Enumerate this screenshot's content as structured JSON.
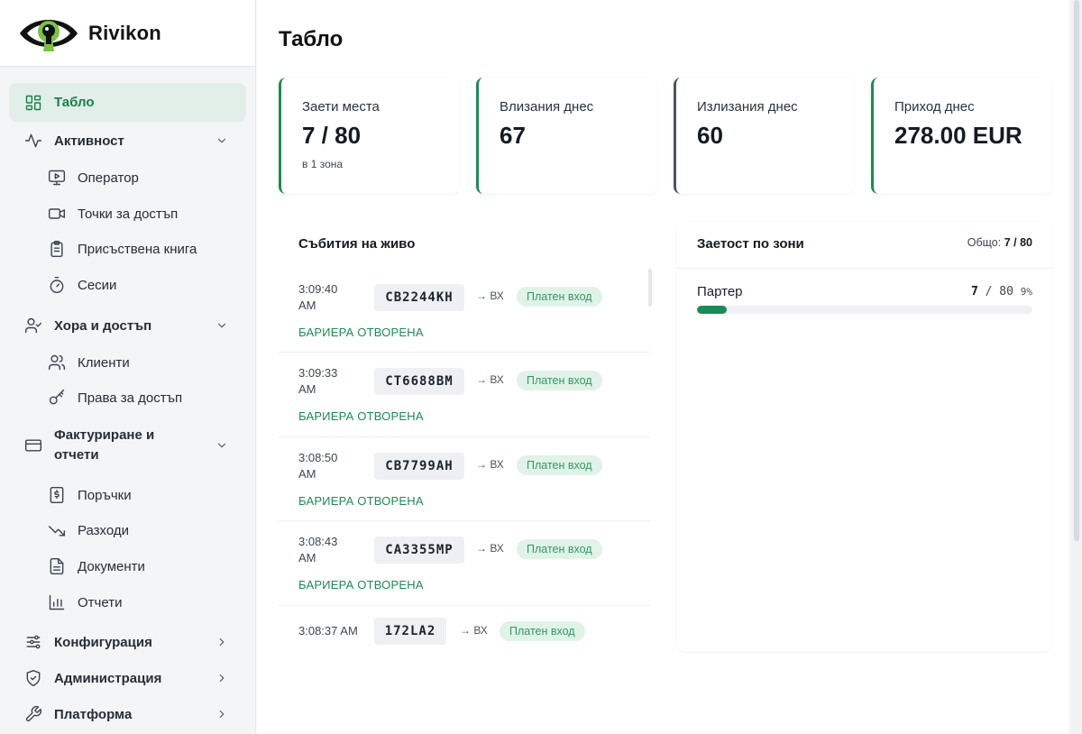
{
  "brand": {
    "name": "Rivikon"
  },
  "sidebar": {
    "items": [
      {
        "label": "Табло",
        "icon": "dashboard-icon",
        "active": true
      },
      {
        "label": "Активност",
        "icon": "activity-icon",
        "expandable": true
      },
      {
        "label": "Оператор",
        "icon": "monitor-play-icon"
      },
      {
        "label": "Точки за достъп",
        "icon": "camera-icon"
      },
      {
        "label": "Присъствена книга",
        "icon": "clipboard-icon"
      },
      {
        "label": "Сесии",
        "icon": "timer-icon"
      },
      {
        "label": "Хора и достъп",
        "icon": "user-check-icon",
        "expandable": true
      },
      {
        "label": "Клиенти",
        "icon": "users-icon"
      },
      {
        "label": "Права за достъп",
        "icon": "key-icon"
      },
      {
        "label": "Фактуриране и",
        "label2": "отчети",
        "icon": "credit-card-icon",
        "expandable": true
      },
      {
        "label": "Поръчки",
        "icon": "receipt-icon"
      },
      {
        "label": "Разходи",
        "icon": "trending-down-icon"
      },
      {
        "label": "Документи",
        "icon": "file-text-icon"
      },
      {
        "label": "Отчети",
        "icon": "bar-chart-icon"
      },
      {
        "label": "Конфигурация",
        "icon": "sliders-icon"
      },
      {
        "label": "Администрация",
        "icon": "shield-icon"
      },
      {
        "label": "Платформа",
        "icon": "wrench-icon"
      }
    ]
  },
  "page": {
    "title": "Табло"
  },
  "kpis": [
    {
      "label": "Заети места",
      "value": "7 / 80",
      "sub": "в 1 зона"
    },
    {
      "label": "Влизания днес",
      "value": "67"
    },
    {
      "label": "Излизания днес",
      "value": "60"
    },
    {
      "label": "Приход днес",
      "value": "278.00 EUR"
    }
  ],
  "events": {
    "title": "Събития на живо",
    "items": [
      {
        "time": "3:09:40 AM",
        "plate": "CB2244KH",
        "direction": "→ ВХ",
        "tag": "Платен вход",
        "result": "БАРИЕРА ОТВОРЕНА"
      },
      {
        "time": "3:09:33 AM",
        "plate": "CT6688BM",
        "direction": "→ ВХ",
        "tag": "Платен вход",
        "result": "БАРИЕРА ОТВОРЕНА"
      },
      {
        "time": "3:08:50 AM",
        "plate": "CB7799AH",
        "direction": "→ ВХ",
        "tag": "Платен вход",
        "result": "БАРИЕРА ОТВОРЕНА"
      },
      {
        "time": "3:08:43 AM",
        "plate": "CA3355MP",
        "direction": "→ ВХ",
        "tag": "Платен вход",
        "result": "БАРИЕРА ОТВОРЕНА"
      },
      {
        "time": "3:08:37 AM",
        "plate": "172LA2",
        "direction": "→ ВХ",
        "tag": "Платен вход",
        "result": ""
      }
    ]
  },
  "zones": {
    "title": "Заетост по зони",
    "total_label": "Общо:",
    "total_value": "7 / 80",
    "items": [
      {
        "name": "Партер",
        "occupied": "7",
        "separator": "/",
        "capacity": "80",
        "percent_label": "9%",
        "fill_fraction": 0.09
      }
    ]
  },
  "colors": {
    "accent": "#1c8a56",
    "accent_bg": "#e1efe8",
    "tag_bg": "#e1f2e9"
  }
}
